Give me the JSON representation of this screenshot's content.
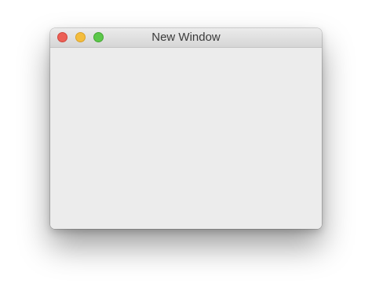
{
  "window": {
    "title": "New Window",
    "controls": {
      "close": {
        "icon": "close-icon",
        "color": "#ec5f55"
      },
      "minimize": {
        "icon": "minimize-icon",
        "color": "#f4bd3d"
      },
      "zoom": {
        "icon": "zoom-icon",
        "color": "#5cc84a"
      }
    },
    "background_color": "#ececec"
  }
}
